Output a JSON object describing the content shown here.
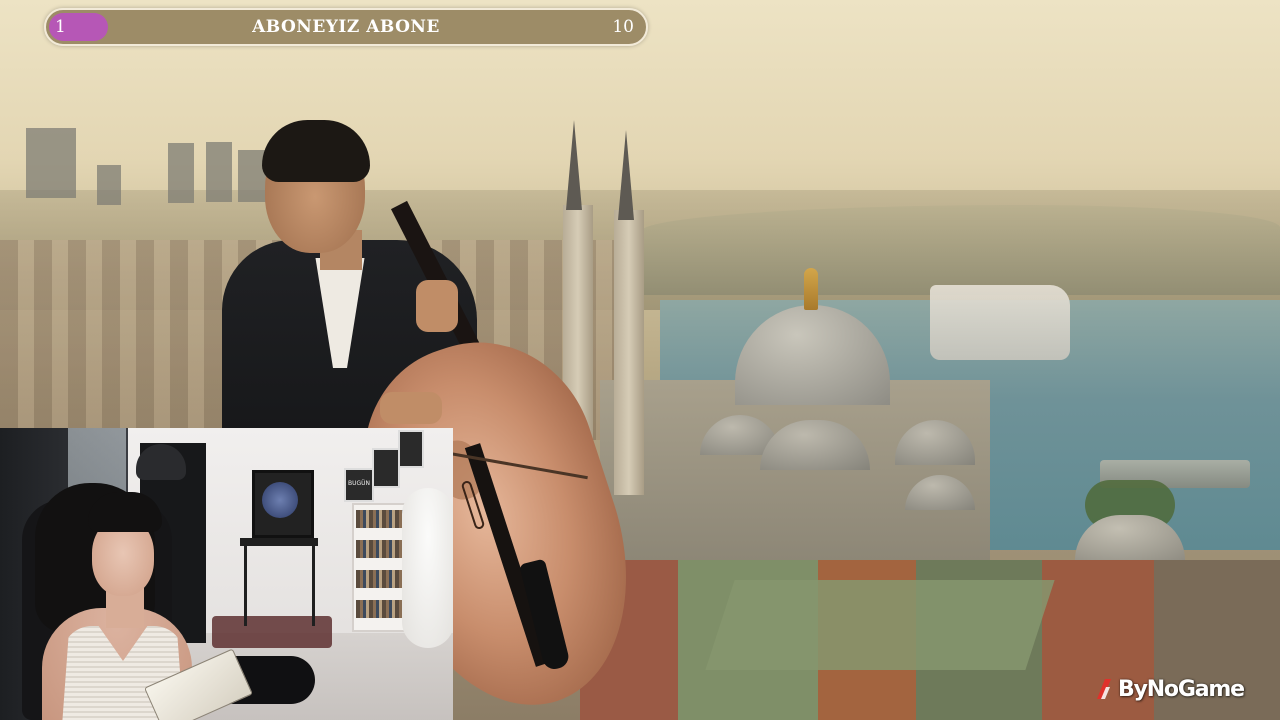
{
  "goal": {
    "start": "1",
    "label": "ABONEYIZ ABONE",
    "end": "10",
    "progress_fraction": 0.1,
    "fill_color": "#b657b6"
  },
  "webcam": {
    "sign_text": "BUGÜN"
  },
  "watermark": {
    "text": "ByNoGame",
    "icon": "bynogame-logo-icon",
    "accent": "#e0312b"
  }
}
